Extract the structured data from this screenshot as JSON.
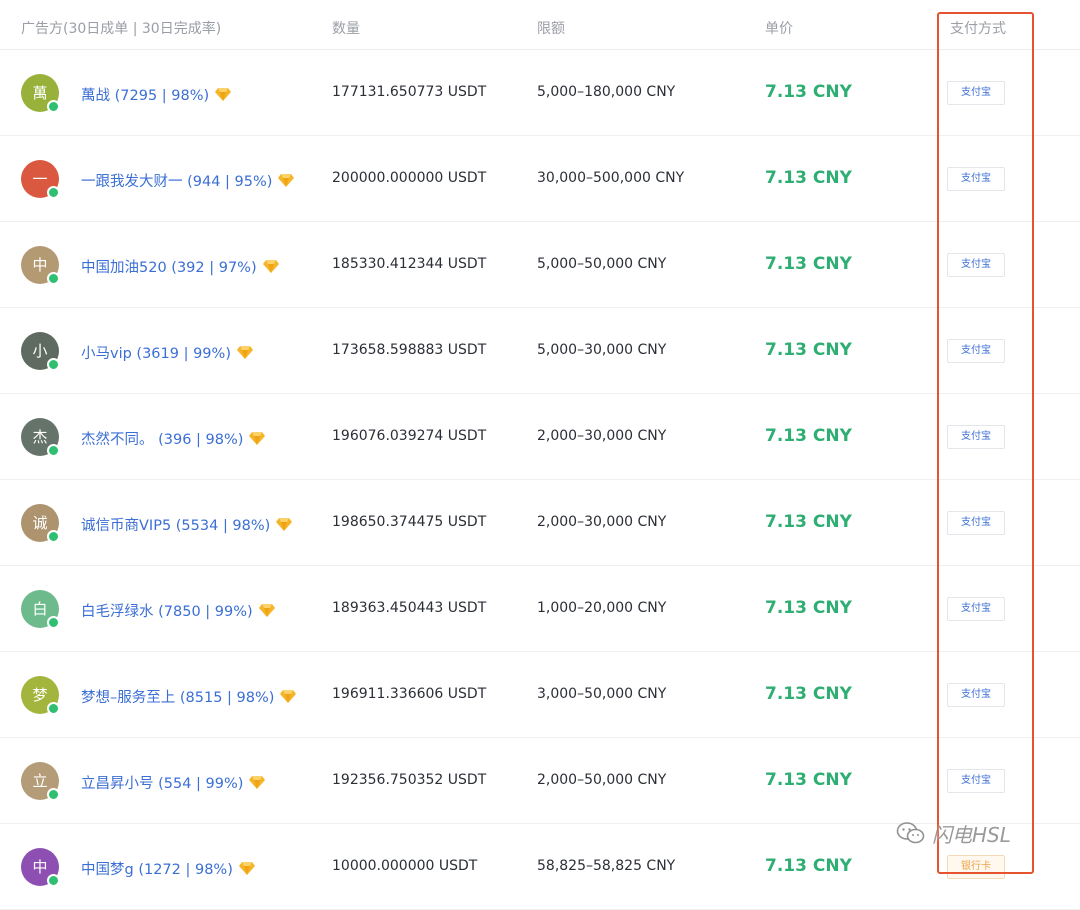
{
  "header": {
    "advertiser": "广告方(30日成单 | 30日完成率)",
    "quantity": "数量",
    "limit": "限额",
    "price": "单价",
    "payment": "支付方式"
  },
  "colors": {
    "price_green": "#2fae73",
    "link_blue": "#3b6fd4",
    "highlight_red": "#e5532f",
    "online_green": "#2fbf71"
  },
  "rows": [
    {
      "avatar": "萬",
      "avatar_color": "#97b13a",
      "name": "萬战 (7295 | 98%)",
      "quantity": "177131.650773 USDT",
      "limit": "5,000–180,000 CNY",
      "price": "7.13 CNY",
      "payment": "支付宝",
      "payment_type": "alipay"
    },
    {
      "avatar": "一",
      "avatar_color": "#d9583f",
      "name": "一跟我发大财一 (944 | 95%)",
      "quantity": "200000.000000 USDT",
      "limit": "30,000–500,000 CNY",
      "price": "7.13 CNY",
      "payment": "支付宝",
      "payment_type": "alipay"
    },
    {
      "avatar": "中",
      "avatar_color": "#b49a72",
      "name": "中国加油520 (392 | 97%)",
      "quantity": "185330.412344 USDT",
      "limit": "5,000–50,000 CNY",
      "price": "7.13 CNY",
      "payment": "支付宝",
      "payment_type": "alipay"
    },
    {
      "avatar": "小",
      "avatar_color": "#5f6b61",
      "name": "小马vip (3619 | 99%)",
      "quantity": "173658.598883 USDT",
      "limit": "5,000–30,000 CNY",
      "price": "7.13 CNY",
      "payment": "支付宝",
      "payment_type": "alipay"
    },
    {
      "avatar": "杰",
      "avatar_color": "#66736a",
      "name": "杰然不同。 (396 | 98%)",
      "quantity": "196076.039274 USDT",
      "limit": "2,000–30,000 CNY",
      "price": "7.13 CNY",
      "payment": "支付宝",
      "payment_type": "alipay"
    },
    {
      "avatar": "诚",
      "avatar_color": "#ad946f",
      "name": "诚信币商VIP5 (5534 | 98%)",
      "quantity": "198650.374475 USDT",
      "limit": "2,000–30,000 CNY",
      "price": "7.13 CNY",
      "payment": "支付宝",
      "payment_type": "alipay"
    },
    {
      "avatar": "白",
      "avatar_color": "#6dbb8c",
      "name": "白毛浮绿水 (7850 | 99%)",
      "quantity": "189363.450443 USDT",
      "limit": "1,000–20,000 CNY",
      "price": "7.13 CNY",
      "payment": "支付宝",
      "payment_type": "alipay"
    },
    {
      "avatar": "梦",
      "avatar_color": "#a4b53e",
      "name": "梦想–服务至上 (8515 | 98%)",
      "quantity": "196911.336606 USDT",
      "limit": "3,000–50,000 CNY",
      "price": "7.13 CNY",
      "payment": "支付宝",
      "payment_type": "alipay"
    },
    {
      "avatar": "立",
      "avatar_color": "#b39c77",
      "name": "立昌昇小号 (554 | 99%)",
      "quantity": "192356.750352 USDT",
      "limit": "2,000–50,000 CNY",
      "price": "7.13 CNY",
      "payment": "支付宝",
      "payment_type": "alipay"
    },
    {
      "avatar": "中",
      "avatar_color": "#8e4fb3",
      "name": "中国梦g (1272 | 98%)",
      "quantity": "10000.000000 USDT",
      "limit": "58,825–58,825 CNY",
      "price": "7.13 CNY",
      "payment": "银行卡",
      "payment_type": "bank"
    }
  ],
  "watermark": "闪电HSL"
}
